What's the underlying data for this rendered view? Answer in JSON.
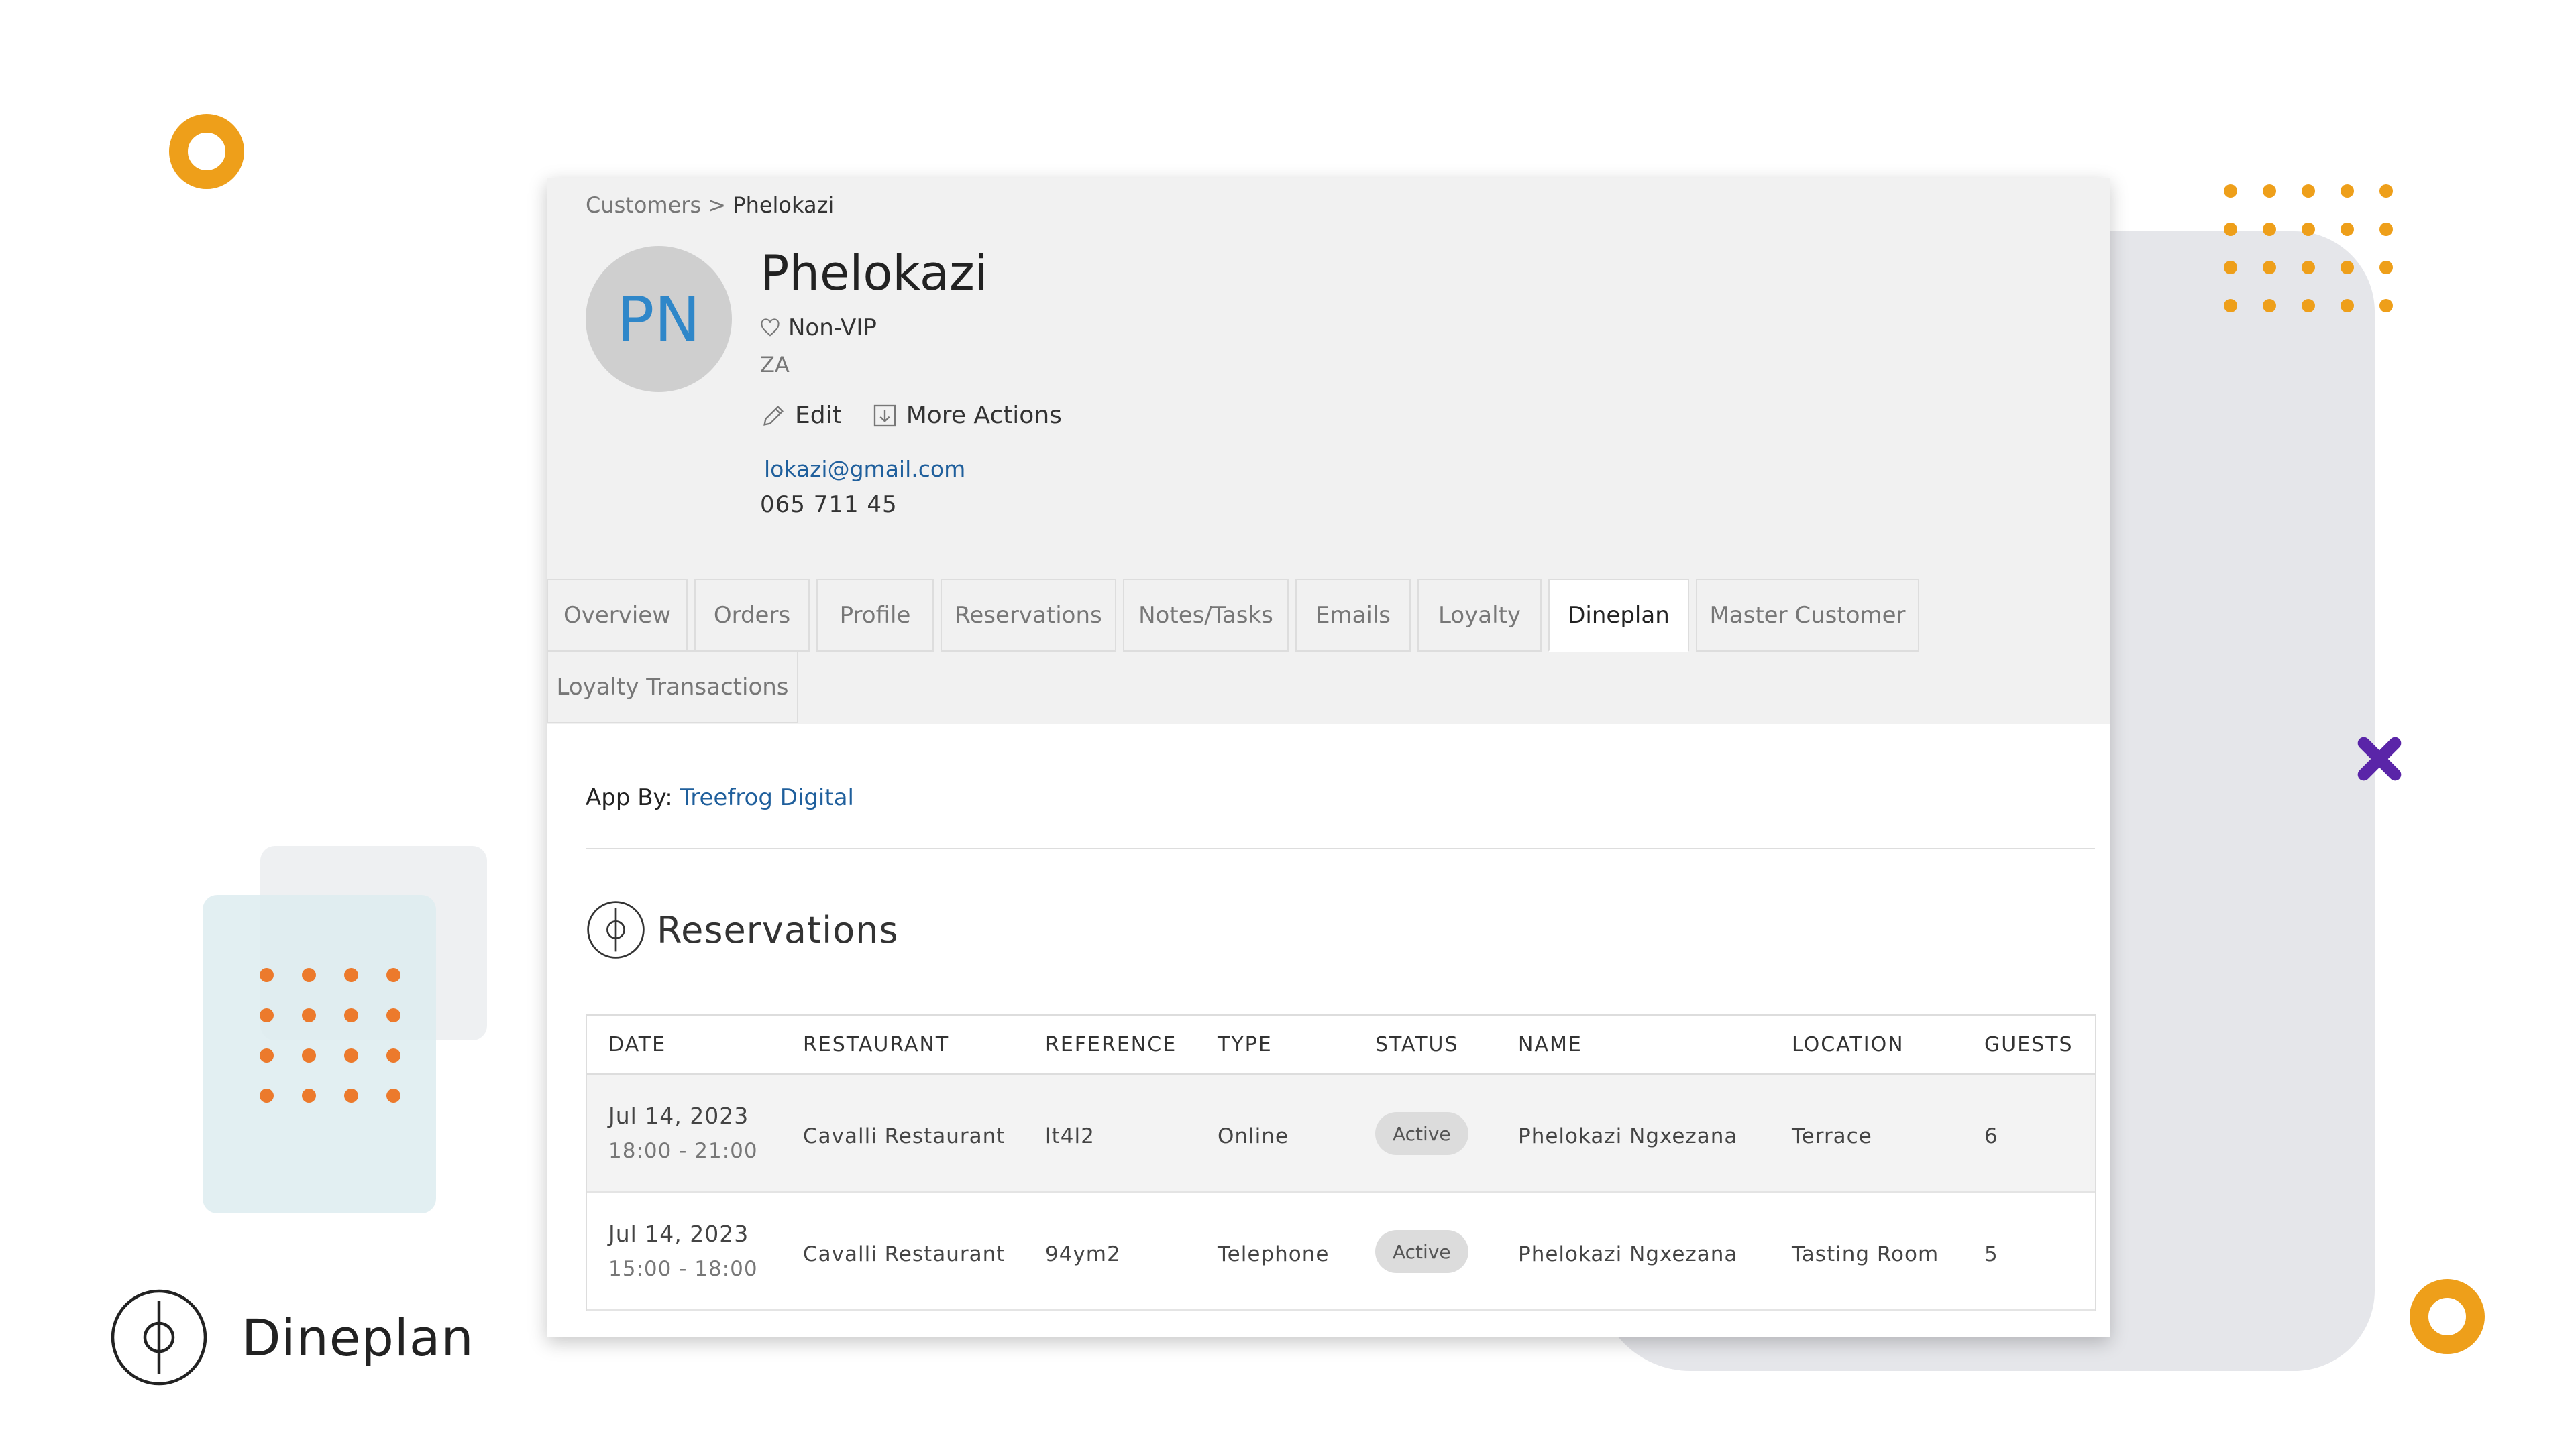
{
  "brand": {
    "name": "Dineplan"
  },
  "breadcrumb": {
    "parent": "Customers",
    "separator": ">",
    "current": "Phelokazi"
  },
  "customer": {
    "initials": "PN",
    "name": "Phelokazi",
    "vip_status": "Non-VIP",
    "country": "ZA",
    "email": "lokazi@gmail.com",
    "phone": "065 711 45"
  },
  "actions": {
    "edit": "Edit",
    "more": "More Actions"
  },
  "tabs": [
    {
      "label": "Overview",
      "active": false
    },
    {
      "label": "Orders",
      "active": false
    },
    {
      "label": "Profile",
      "active": false
    },
    {
      "label": "Reservations",
      "active": false
    },
    {
      "label": "Notes/Tasks",
      "active": false
    },
    {
      "label": "Emails",
      "active": false
    },
    {
      "label": "Loyalty",
      "active": false
    },
    {
      "label": "Dineplan",
      "active": true
    },
    {
      "label": "Master Customer",
      "active": false
    },
    {
      "label": "Loyalty Transactions",
      "active": false
    }
  ],
  "app_by": {
    "label": "App By:",
    "link": "Treefrog Digital"
  },
  "reservations": {
    "title": "Reservations",
    "columns": [
      "DATE",
      "RESTAURANT",
      "REFERENCE",
      "TYPE",
      "STATUS",
      "NAME",
      "LOCATION",
      "GUESTS"
    ],
    "rows": [
      {
        "date": "Jul 14, 2023",
        "time": "18:00 - 21:00",
        "restaurant": "Cavalli Restaurant",
        "reference": "lt4l2",
        "type": "Online",
        "status": "Active",
        "name": "Phelokazi Ngxezana",
        "location": "Terrace",
        "guests": "6"
      },
      {
        "date": "Jul 14, 2023",
        "time": "15:00 - 18:00",
        "restaurant": "Cavalli Restaurant",
        "reference": "94ym2",
        "type": "Telephone",
        "status": "Active",
        "name": "Phelokazi Ngxezana",
        "location": "Tasting Room",
        "guests": "5"
      }
    ]
  },
  "colors": {
    "accent_orange": "#ee9f1a",
    "dot_orange": "#ec7a2c",
    "x_purple": "#5a25a8",
    "link_blue": "#1f5f9c",
    "avatar_text": "#2f87c9"
  }
}
